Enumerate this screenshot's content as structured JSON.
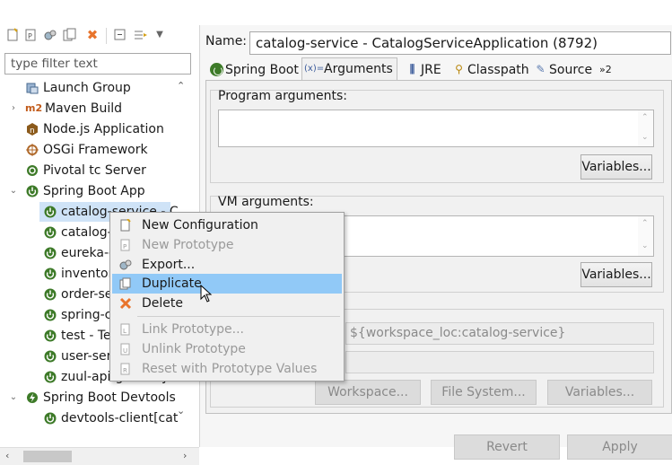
{
  "filter": {
    "placeholder": "type filter text"
  },
  "tree": {
    "items": [
      {
        "label": "Launch Group",
        "twisty": ""
      },
      {
        "label": "Maven Build",
        "twisty": "›"
      },
      {
        "label": "Node.js Application",
        "twisty": ""
      },
      {
        "label": "OSGi Framework",
        "twisty": ""
      },
      {
        "label": "Pivotal tc Server",
        "twisty": ""
      },
      {
        "label": "Spring Boot App",
        "twisty": "⌄"
      },
      {
        "label": "catalog-service - C",
        "twisty": ""
      },
      {
        "label": "catalog-",
        "twisty": ""
      },
      {
        "label": "eureka-c",
        "twisty": ""
      },
      {
        "label": "inventor",
        "twisty": ""
      },
      {
        "label": "order-se",
        "twisty": ""
      },
      {
        "label": "spring-c",
        "twisty": ""
      },
      {
        "label": "test - Te",
        "twisty": ""
      },
      {
        "label": "user-ser",
        "twisty": ""
      },
      {
        "label": "zuul-api-gateway",
        "twisty": ""
      },
      {
        "label": "Spring Boot Devtools",
        "twisty": "⌄"
      },
      {
        "label": "devtools-client[cat",
        "twisty": ""
      }
    ],
    "m2_badge": "m2",
    "node_badge": "n"
  },
  "config": {
    "name_label": "Name:",
    "name_value": "catalog-service - CatalogServiceApplication (8792)"
  },
  "tabs": [
    {
      "label": "Spring Boot"
    },
    {
      "label": "Arguments"
    },
    {
      "label": "JRE"
    },
    {
      "label": "Classpath"
    },
    {
      "label": "Source"
    },
    {
      "label": "»2"
    }
  ],
  "arguments": {
    "program_title": "Program arguments:",
    "program_value": "",
    "variables_label": "Variables...",
    "vm_title": "VM arguments:",
    "vm_value": "",
    "vm_variables_label": "Variables...",
    "workdir_value": "${workspace_loc:catalog-service}",
    "workspace_label": "Workspace...",
    "filesystem_label": "File System...",
    "workdir_variables_label": "Variables..."
  },
  "footer": {
    "revert_label": "Revert",
    "apply_label": "Apply"
  },
  "context_menu": {
    "items": [
      {
        "label": "New Configuration",
        "icon": "new-config-icon",
        "enabled": true
      },
      {
        "label": "New Prototype",
        "icon": "new-prototype-icon",
        "enabled": false
      },
      {
        "label": "Export...",
        "icon": "export-icon",
        "enabled": true
      },
      {
        "label": "Duplicate",
        "icon": "duplicate-icon",
        "enabled": true,
        "hover": true
      },
      {
        "label": "Delete",
        "icon": "delete-icon",
        "enabled": true
      },
      {
        "label": "Link Prototype...",
        "icon": "link-prototype-icon",
        "enabled": false
      },
      {
        "label": "Unlink Prototype",
        "icon": "unlink-prototype-icon",
        "enabled": false
      },
      {
        "label": "Reset with Prototype Values",
        "icon": "reset-prototype-icon",
        "enabled": false
      }
    ]
  },
  "colors": {
    "menu_hover": "#91c9f7",
    "selection": "#cfe3f7",
    "spring_green": "#3d7a28",
    "delete_orange": "#e8742c"
  }
}
